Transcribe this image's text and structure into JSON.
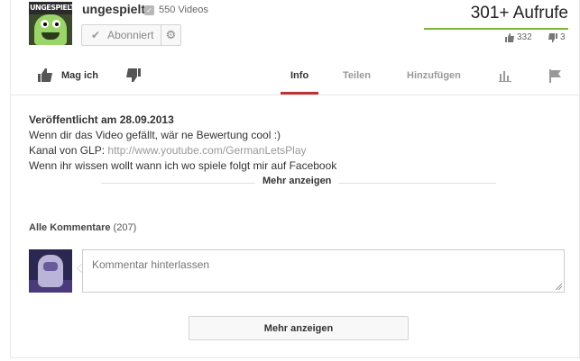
{
  "channel": {
    "name": "ungespielt",
    "avatar_text": "UNGESPIELT",
    "video_count": "550 Videos",
    "subscribe_label": "Abonniert"
  },
  "stats": {
    "views": "301+ Aufrufe",
    "likes": "332",
    "dislikes": "3",
    "accent_color": "#7ab838"
  },
  "actions": {
    "like_label": "Mag ich",
    "tabs": [
      {
        "label": "Info",
        "active": true
      },
      {
        "label": "Teilen",
        "active": false
      },
      {
        "label": "Hinzufügen",
        "active": false
      }
    ],
    "icons": [
      "thumb-up-icon",
      "thumb-down-icon",
      "stats-icon",
      "flag-icon"
    ]
  },
  "description": {
    "published": "Veröffentlicht am 28.09.2013",
    "line1": "Wenn dir das Video gefällt, wär ne Bewertung cool :)",
    "line2_prefix": "Kanal von GLP: ",
    "line2_link": "http://www.youtube.com/GermanLetsPlay",
    "line3": "Wenn ihr wissen wollt wann ich wo spiele folgt mir auf Facebook",
    "more_label": "Mehr anzeigen"
  },
  "comments": {
    "title": "Alle Kommentare",
    "count": "(207)",
    "placeholder": "Kommentar hinterlassen",
    "more_label": "Mehr anzeigen"
  }
}
